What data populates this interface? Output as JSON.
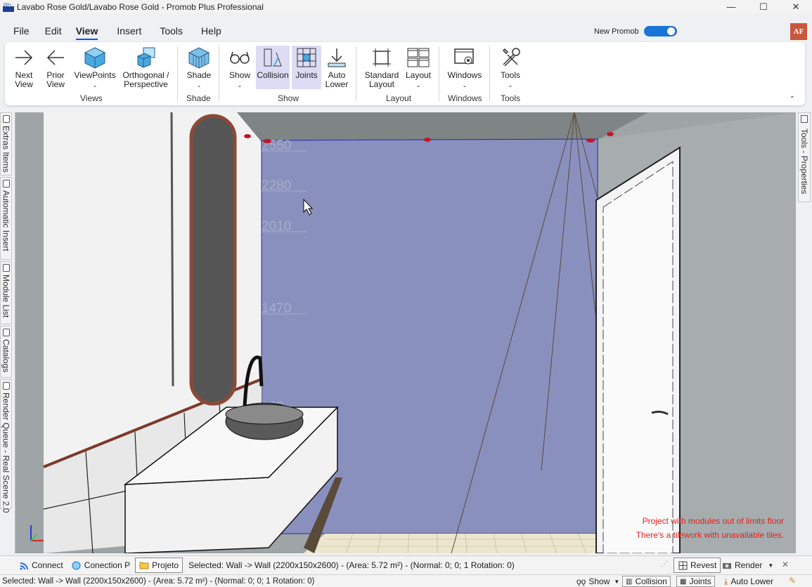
{
  "window": {
    "title": "Lavabo Rose Gold/Lavabo Rose Gold - Promob Plus Professional",
    "minimize": "—",
    "maximize": "☐",
    "close": "✕"
  },
  "menu": [
    "File",
    "Edit",
    "View",
    "Insert",
    "Tools",
    "Help"
  ],
  "active_menu": "View",
  "new_promob": {
    "label": "New Promob",
    "enabled": true
  },
  "avatar": "AF",
  "ribbon": {
    "next_view": [
      "Next",
      "View"
    ],
    "prior_view": [
      "Prior",
      "View"
    ],
    "viewpoints": "ViewPoints",
    "orthogonal": [
      "Orthogonal /",
      "Perspective"
    ],
    "views_label": "Views",
    "shade": "Shade",
    "shade_label": "Shade",
    "show": "Show",
    "collision": "Collision",
    "joints": "Joints",
    "auto_lower": [
      "Auto",
      "Lower"
    ],
    "show_label": "Show",
    "standard_layout": [
      "Standard",
      "Layout"
    ],
    "layout": "Layout",
    "layout_label": "Layout",
    "windows": "Windows",
    "windows_label": "Windows",
    "tools": "Tools",
    "tools_label": "Tools",
    "collapse": "⌃"
  },
  "left_tabs": [
    "Extras Items",
    "Automatic Insert",
    "Module List",
    "Catalogs",
    "Render Queue - Real Scene 2.0"
  ],
  "right_tab": "Tools - Properties",
  "viewport": {
    "dimensions": [
      "2550",
      "2280",
      "2010",
      "1470",
      "930"
    ],
    "warnings": [
      "Project with modules out of limits floor",
      "There's a tilework with unavailable tiles."
    ],
    "wall_color": "#8a90be"
  },
  "statusbar": {
    "connect": "Connect",
    "conection": "Conection P",
    "projeto": "Projeto",
    "selected": "Selected: Wall -> Wall (2200x150x2600) - (Area: 5.72 m²) - (Normal: 0; 0; 1 Rotation: 0)",
    "revest": "Revest",
    "render": "Render",
    "close": "✕"
  },
  "statusbar2": {
    "selected": "Selected: Wall -> Wall (2200x150x2600) - (Area: 5.72 m²) - (Normal: 0; 0; 1 Rotation: 0)",
    "show": "Show",
    "collision": "Collision",
    "joints": "Joints",
    "auto_lower": "Auto Lower"
  }
}
